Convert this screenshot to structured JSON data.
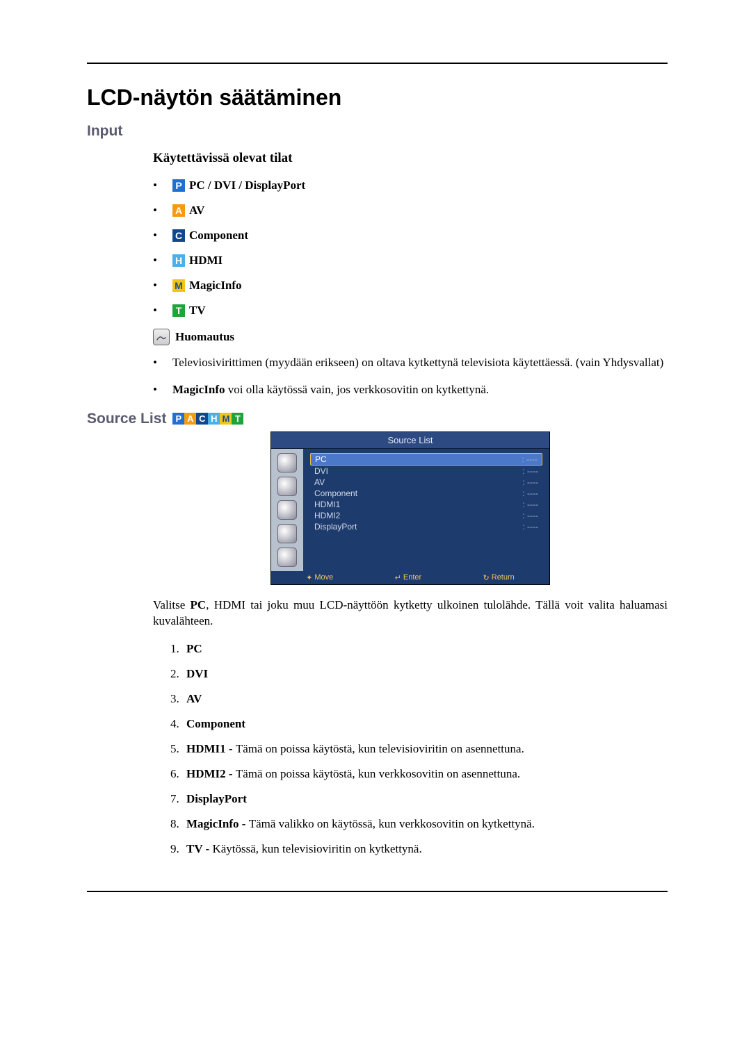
{
  "title": "LCD-näytön säätäminen",
  "input": {
    "heading": "Input",
    "modes_heading": "Käytettävissä olevat tilat",
    "modes": [
      {
        "icon": "P",
        "iconClass": "icon-blue",
        "label": "PC / DVI / DisplayPort"
      },
      {
        "icon": "A",
        "iconClass": "icon-orange",
        "label": "AV"
      },
      {
        "icon": "C",
        "iconClass": "icon-dblue",
        "label": "Component"
      },
      {
        "icon": "H",
        "iconClass": "icon-sky",
        "label": "HDMI"
      },
      {
        "icon": "M",
        "iconClass": "icon-yellow",
        "label": "MagicInfo"
      },
      {
        "icon": "T",
        "iconClass": "icon-green",
        "label": "TV"
      }
    ],
    "note_label": "Huomautus",
    "notes": [
      "Televiosivirittimen (myydään erikseen) on oltava kytkettynä televisiota käytettäessä. (vain Yhdysvallat)",
      "MagicInfo voi olla käytössä vain, jos verkkosovitin on kytkettynä."
    ],
    "notes_bold_prefix": [
      "",
      "MagicInfo "
    ],
    "notes_rest": [
      "Televiosivirittimen (myydään erikseen) on oltava kytkettynä televisiota käytettäessä. (vain Yhdysvallat)",
      "voi olla käytössä vain, jos verkkosovitin on kytkettynä."
    ]
  },
  "source_list": {
    "heading": "Source List",
    "icons": [
      "P",
      "A",
      "C",
      "H",
      "M",
      "T"
    ],
    "iconClasses": [
      "icon-blue",
      "icon-orange",
      "icon-dblue",
      "icon-sky",
      "icon-yellow",
      "icon-green"
    ],
    "osd_title": "Source List",
    "osd_rows": [
      {
        "label": "PC",
        "value": ": ----",
        "selected": true
      },
      {
        "label": "DVI",
        "value": ": ----"
      },
      {
        "label": "AV",
        "value": ": ----"
      },
      {
        "label": "Component",
        "value": ": ----"
      },
      {
        "label": "HDMI1",
        "value": ": ----"
      },
      {
        "label": "HDMI2",
        "value": ": ----"
      },
      {
        "label": "DisplayPort",
        "value": ": ----"
      }
    ],
    "osd_footer": {
      "move": "Move",
      "enter": "Enter",
      "ret": "Return"
    },
    "intro_prefix": "Valitse ",
    "intro_bold": "PC",
    "intro_rest": ", HDMI tai joku muu LCD-näyttöön kytketty ulkoinen tulolähde. Tällä voit valita haluamasi kuvalähteen.",
    "items": [
      {
        "bold": "PC",
        "rest": ""
      },
      {
        "bold": "DVI",
        "rest": ""
      },
      {
        "bold": "AV",
        "rest": ""
      },
      {
        "bold": "Component",
        "rest": ""
      },
      {
        "bold": "HDMI1 - ",
        "rest": "Tämä on poissa käytöstä, kun televisioviritin on asennettuna."
      },
      {
        "bold": "HDMI2 - ",
        "rest": "Tämä on poissa käytöstä, kun verkkosovitin on asennettuna."
      },
      {
        "bold": "DisplayPort",
        "rest": ""
      },
      {
        "bold": "MagicInfo - ",
        "rest": "Tämä valikko on käytössä, kun verkkosovitin on kytkettynä."
      },
      {
        "bold": "TV - ",
        "rest": "Käytössä, kun televisioviritin on kytkettynä."
      }
    ]
  }
}
